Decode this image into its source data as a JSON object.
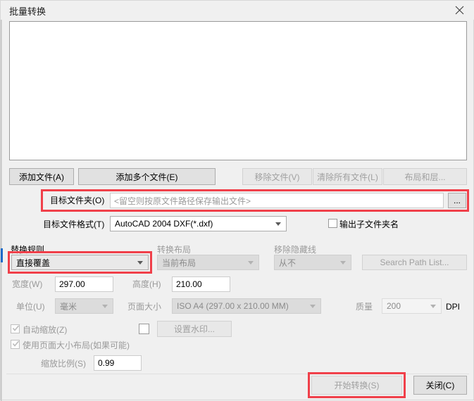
{
  "window": {
    "title": "批量转换",
    "close_icon": "close-icon"
  },
  "file_list": {
    "items": []
  },
  "file_buttons": {
    "add_file": "添加文件(A)",
    "add_multiple": "添加多个文件(E)",
    "remove_file": "移除文件(V)",
    "clear_all": "清除所有文件(L)",
    "layout_layer": "布局和层..."
  },
  "target_folder": {
    "label": "目标文件夹(O)",
    "value": "",
    "placeholder": "<留空则按原文件路径保存输出文件>",
    "browse_label": "...",
    "highlighted": true
  },
  "target_format": {
    "label": "目标文件格式(T)",
    "value": "AutoCAD 2004 DXF(*.dxf)"
  },
  "output_subfolder": {
    "label": "输出子文件夹名",
    "checked": false
  },
  "replace_rule": {
    "group_label": "替换规则",
    "value": "直接覆盖",
    "highlighted": true
  },
  "convert_layout": {
    "group_label": "转换布局",
    "value": "当前布局",
    "disabled": true
  },
  "remove_hidden_lines": {
    "group_label": "移除隐藏线",
    "value": "从不",
    "disabled": true
  },
  "search_path": {
    "label": "Search Path List...",
    "disabled": true
  },
  "size": {
    "width_label": "宽度(W)",
    "width_value": "297.00",
    "height_label": "高度(H)",
    "height_value": "210.00",
    "unit_label": "单位(U)",
    "unit_value": "毫米",
    "page_size_label": "页面大小",
    "page_size_value": "ISO A4 (297.00 x 210.00 MM)",
    "quality_label": "质量",
    "quality_value": "200",
    "dpi_label": "DPI"
  },
  "options": {
    "auto_scale_label": "自动缩放(Z)",
    "auto_scale_checked": true,
    "use_page_layout_label": "使用页面大小布局(如果可能)",
    "use_page_layout_checked": true,
    "watermark_checked": false,
    "watermark_button": "设置水印...",
    "scale_ratio_label": "缩放比例(S)",
    "scale_ratio_value": "0.99"
  },
  "footer": {
    "start_label": "开始转换(S)",
    "start_disabled": true,
    "start_highlighted": true,
    "close_label": "关闭(C)"
  },
  "colors": {
    "highlight": "#f0404a",
    "accent": "#1b6ac9",
    "window_bg": "#f0f0f0",
    "disabled_text": "#9a9a9a"
  }
}
